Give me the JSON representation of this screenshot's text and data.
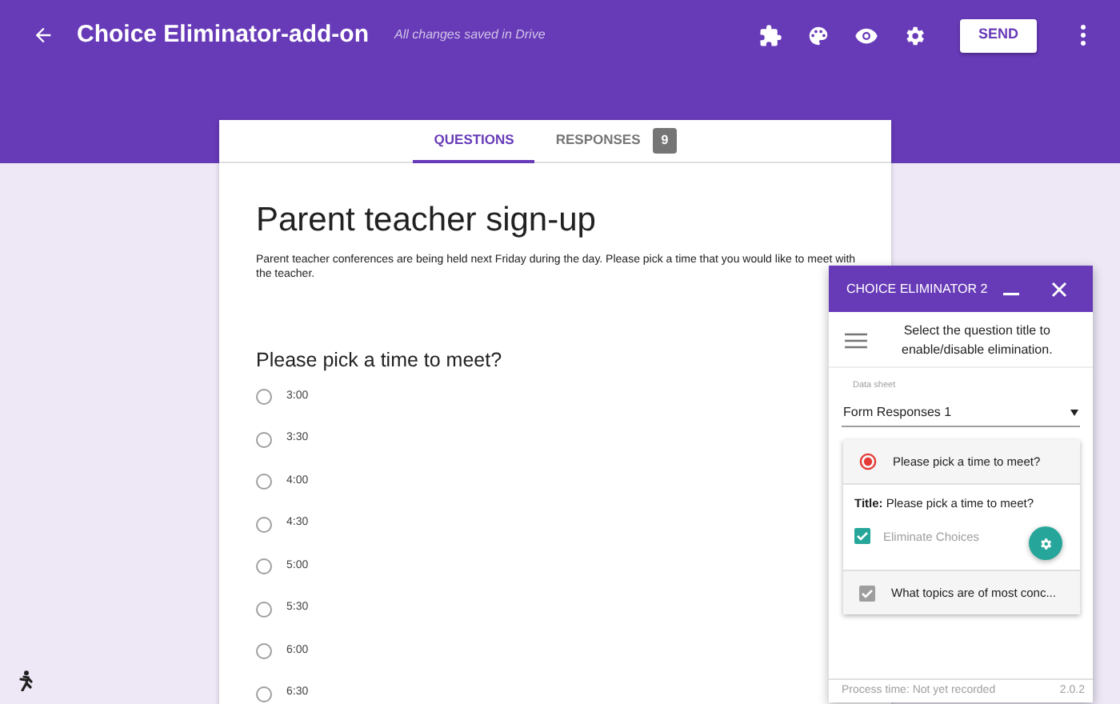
{
  "app_bar": {
    "title": "Choice Eliminator-add-on",
    "save_status": "All changes saved in Drive",
    "send_button": "SEND"
  },
  "tabs": [
    {
      "label": "QUESTIONS",
      "selected": true
    },
    {
      "label": "RESPONSES",
      "selected": false,
      "count": "9"
    }
  ],
  "form": {
    "title": "Parent teacher sign-up",
    "description": "Parent teacher conferences are being held next Friday during the day.  Please pick a time that you would like to meet with the teacher.",
    "question": {
      "title": "Please pick a time to meet?",
      "options": [
        {
          "label": "3:00",
          "selected": false
        },
        {
          "label": "3:30",
          "selected": false
        },
        {
          "label": "4:00",
          "selected": false
        },
        {
          "label": "4:30",
          "selected": false
        },
        {
          "label": "5:00",
          "selected": false
        },
        {
          "label": "5:30",
          "selected": false
        },
        {
          "label": "6:00",
          "selected": false
        },
        {
          "label": "6:30",
          "selected": false
        }
      ]
    }
  },
  "addon_panel": {
    "title": "CHOICE ELIMINATOR 2",
    "instructions": "Select the question title to enable/disable elimination.",
    "data_sheet": {
      "label": "Data sheet",
      "value": "Form Responses 1"
    },
    "questions": [
      {
        "title": "Please pick a time to meet?",
        "kind": "radio",
        "on": true,
        "expanded": true,
        "detail": "**Title:** Please pick a time to meet?",
        "eliminate": {
          "label": "Eliminate Choices",
          "checked": true
        }
      },
      {
        "title": "What topics are of most conc...",
        "kind": "checkbox",
        "on": true,
        "expanded": false
      }
    ],
    "footer": {
      "process_time": "Process time: Not yet recorded",
      "version": "2.0.2"
    }
  }
}
